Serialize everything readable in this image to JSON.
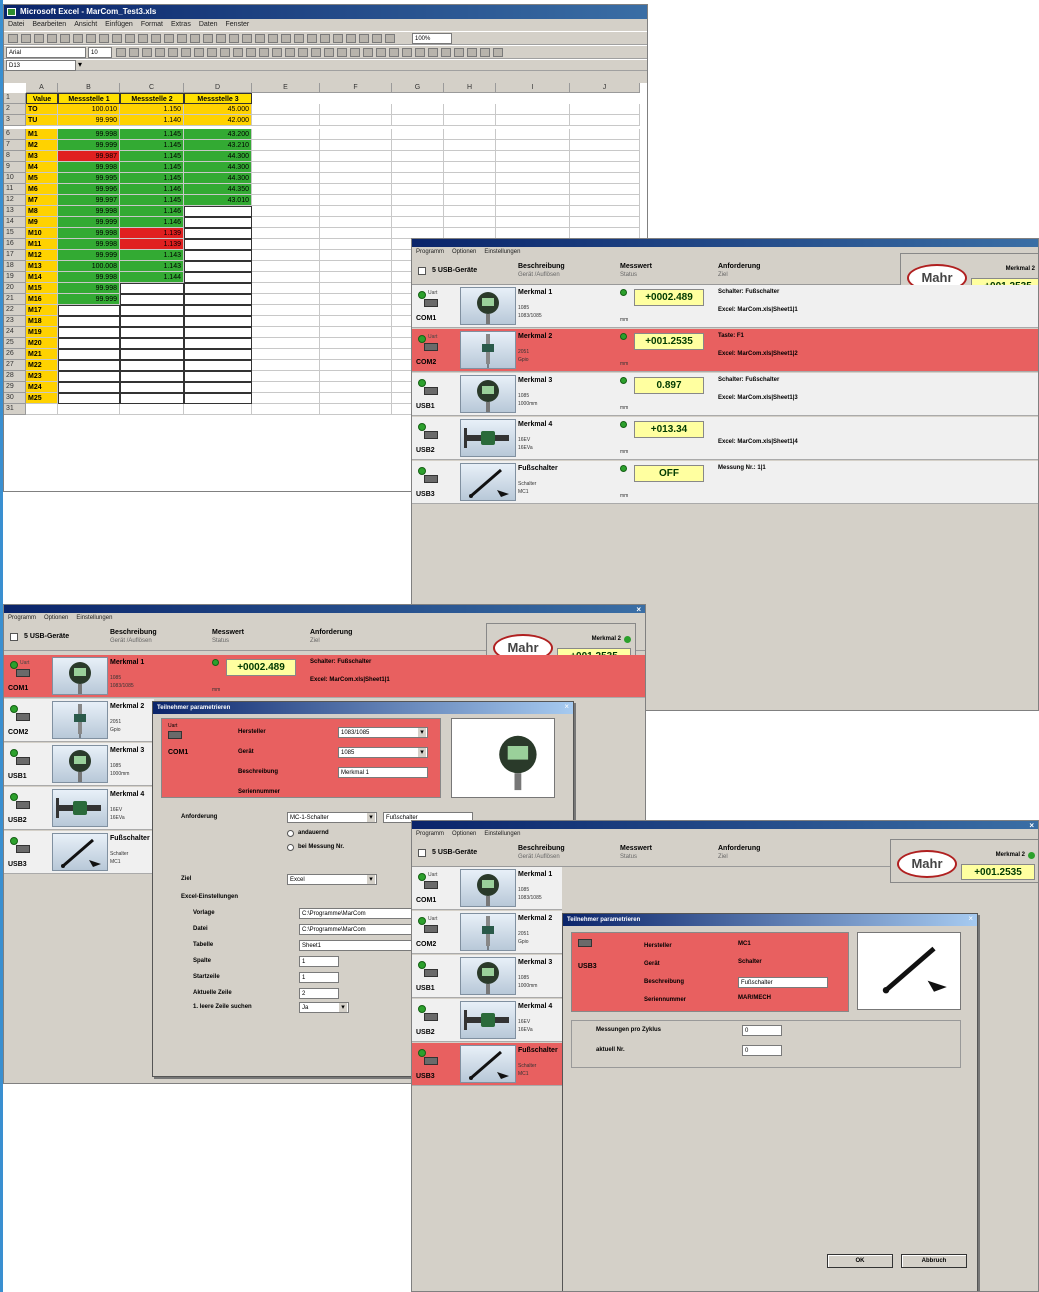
{
  "excel": {
    "title": "Microsoft Excel - MarCom_Test3.xls",
    "menu": [
      "Datei",
      "Bearbeiten",
      "Ansicht",
      "Einfügen",
      "Format",
      "Extras",
      "Daten",
      "Fenster"
    ],
    "zoom": "100%",
    "font_name": "Arial",
    "font_size": "10",
    "name_box": "D13",
    "columns": [
      "A",
      "B",
      "C",
      "D",
      "E",
      "F",
      "G",
      "H",
      "I",
      "J"
    ],
    "headers": [
      "Value",
      "Messstelle 1",
      "Messstelle 2",
      "Messstelle 3"
    ],
    "rows": [
      {
        "n": "2",
        "label": "TO",
        "b": "100.010",
        "c": "1.150",
        "d": "45.000",
        "style": "tol"
      },
      {
        "n": "3",
        "label": "TU",
        "b": "99.990",
        "c": "1.140",
        "d": "42.000",
        "style": "tol"
      },
      {
        "n": "6",
        "label": "M1",
        "b": "99.998",
        "c": "1.145",
        "d": "43.200",
        "style": "ok"
      },
      {
        "n": "7",
        "label": "M2",
        "b": "99.999",
        "c": "1.145",
        "d": "43.210",
        "style": "ok"
      },
      {
        "n": "8",
        "label": "M3",
        "b": "99.987",
        "c": "1.145",
        "d": "44.300",
        "style": "bad_b"
      },
      {
        "n": "9",
        "label": "M4",
        "b": "99.998",
        "c": "1.145",
        "d": "44.300",
        "style": "ok"
      },
      {
        "n": "10",
        "label": "M5",
        "b": "99.995",
        "c": "1.145",
        "d": "44.300",
        "style": "ok"
      },
      {
        "n": "11",
        "label": "M6",
        "b": "99.996",
        "c": "1.146",
        "d": "44.350",
        "style": "ok"
      },
      {
        "n": "12",
        "label": "M7",
        "b": "99.997",
        "c": "1.145",
        "d": "43.010",
        "style": "ok"
      },
      {
        "n": "13",
        "label": "M8",
        "b": "99.998",
        "c": "1.146",
        "d": "",
        "style": "ok_bc"
      },
      {
        "n": "14",
        "label": "M9",
        "b": "99.999",
        "c": "1.146",
        "d": "",
        "style": "ok_bc"
      },
      {
        "n": "15",
        "label": "M10",
        "b": "99.998",
        "c": "1.139",
        "d": "",
        "style": "bad_c"
      },
      {
        "n": "16",
        "label": "M11",
        "b": "99.998",
        "c": "1.139",
        "d": "",
        "style": "bad_c"
      },
      {
        "n": "17",
        "label": "M12",
        "b": "99.999",
        "c": "1.143",
        "d": "",
        "style": "ok_bc"
      },
      {
        "n": "18",
        "label": "M13",
        "b": "100.008",
        "c": "1.143",
        "d": "",
        "style": "ok_bc"
      },
      {
        "n": "19",
        "label": "M14",
        "b": "99.998",
        "c": "1.144",
        "d": "",
        "style": "ok_bc"
      },
      {
        "n": "20",
        "label": "M15",
        "b": "99.998",
        "c": "",
        "d": "",
        "style": "ok_b"
      },
      {
        "n": "21",
        "label": "M16",
        "b": "99.999",
        "c": "",
        "d": "",
        "style": "ok_b"
      },
      {
        "n": "22",
        "label": "M17",
        "b": "",
        "c": "",
        "d": "",
        "style": "empty"
      },
      {
        "n": "23",
        "label": "M18",
        "b": "",
        "c": "",
        "d": "",
        "style": "empty"
      },
      {
        "n": "24",
        "label": "M19",
        "b": "",
        "c": "",
        "d": "",
        "style": "empty"
      },
      {
        "n": "25",
        "label": "M20",
        "b": "",
        "c": "",
        "d": "",
        "style": "empty"
      },
      {
        "n": "26",
        "label": "M21",
        "b": "",
        "c": "",
        "d": "",
        "style": "empty"
      },
      {
        "n": "27",
        "label": "M22",
        "b": "",
        "c": "",
        "d": "",
        "style": "empty"
      },
      {
        "n": "28",
        "label": "M23",
        "b": "",
        "c": "",
        "d": "",
        "style": "empty"
      },
      {
        "n": "29",
        "label": "M24",
        "b": "",
        "c": "",
        "d": "",
        "style": "empty"
      },
      {
        "n": "30",
        "label": "M25",
        "b": "",
        "c": "",
        "d": "",
        "style": "empty"
      },
      {
        "n": "31",
        "label": "",
        "b": "",
        "c": "",
        "d": "",
        "style": "blank"
      }
    ]
  },
  "marcom": {
    "menu": [
      "Programm",
      "Optionen",
      "Einstellungen"
    ],
    "header": {
      "devices": "5 USB-Geräte",
      "desc": "Beschreibung",
      "desc_sub": "Gerät /Auflösen",
      "value": "Messwert",
      "value_sub": "Status",
      "req": "Anforderung",
      "req_sub": "Ziel"
    },
    "mahr": {
      "logo": "Mahr",
      "label": "Merkmal 2",
      "value": "+001.2535"
    },
    "devices": [
      {
        "tag": "Uart",
        "port": "COM1",
        "name": "Merkmal 1",
        "s1": "1085",
        "s2": "1083/1085",
        "unit": "mm",
        "value": "+0002.489",
        "a1": "Schalter: Fußschalter",
        "a2": "Excel: MarCom.xls|Sheet1|1"
      },
      {
        "tag": "Uart",
        "port": "COM2",
        "name": "Merkmal 2",
        "s1": "2051",
        "s2": "Gpio",
        "unit": "mm",
        "value": "+001.2535",
        "a1": "Taste: F1",
        "a2": "Excel: MarCom.xls|Sheet1|2"
      },
      {
        "tag": "",
        "port": "USB1",
        "name": "Merkmal 3",
        "s1": "1085",
        "s2": "1000mm",
        "unit": "mm",
        "value": "0.897",
        "a1": "Schalter: Fußschalter",
        "a2": "Excel: MarCom.xls|Sheet1|3"
      },
      {
        "tag": "",
        "port": "USB2",
        "name": "Merkmal 4",
        "s1": "16EV",
        "s2": "16EVa",
        "unit": "mm",
        "value": "+013.34",
        "a1": "",
        "a2": "Excel: MarCom.xls|Sheet1|4"
      },
      {
        "tag": "",
        "port": "USB3",
        "name": "Fußschalter",
        "s1": "Schalter",
        "s2": "MC1",
        "unit": "mm",
        "value": "OFF",
        "a1": "Messung Nr.: 1|1",
        "a2": ""
      }
    ],
    "dialog1": {
      "title": "Teilnehmer parametrieren",
      "port": "COM1",
      "tag": "Uart",
      "f_hersteller": "Hersteller",
      "v_hersteller": "1083/1085",
      "f_geraet": "Gerät",
      "v_geraet": "1085",
      "f_beschreibung": "Beschreibung",
      "v_beschreibung": "Merkmal 1",
      "f_seriennummer": "Seriennummer",
      "anforderung": "Anforderung",
      "v_anforderung": "MC-1-Schalter",
      "v_anforderung2": "Fußschalter",
      "opt1": "andauernd",
      "opt2": "bei Messung Nr.",
      "ziel": "Ziel",
      "v_ziel": "Excel",
      "excel_settings": "Excel-Einstellungen",
      "f_vorlage": "Vorlage",
      "v_vorlage": "C:\\Programme\\MarCom",
      "f_datei": "Datei",
      "v_datei": "C:\\Programme\\MarCom",
      "f_tabelle": "Tabelle",
      "v_tabelle": "Sheet1",
      "f_spalte": "Spalte",
      "v_spalte": "1",
      "f_startzeile": "Startzeile",
      "v_startzeile": "1",
      "f_aktuelle": "Aktuelle Zeile",
      "v_aktuelle": "2",
      "f_leere": "1. leere Zeile suchen",
      "v_leere": "Ja"
    },
    "dialog2": {
      "title": "Teilnehmer parametrieren",
      "port": "USB3",
      "f_hersteller": "Hersteller",
      "v_hersteller": "MC1",
      "f_geraet": "Gerät",
      "v_geraet": "Schalter",
      "f_beschreibung": "Beschreibung",
      "v_beschreibung": "Fußschalter",
      "f_seriennummer": "Seriennummer",
      "v_seriennummer": "MAR/MECH",
      "f_messungen": "Messungen pro Zyklus",
      "v_messungen": "0",
      "f_aktuell": "aktuell Nr.",
      "v_aktuell": "0",
      "ok": "OK",
      "cancel": "Abbruch"
    }
  },
  "colors": {
    "green": "#33aa33",
    "red": "#e02020",
    "yellow": "#ffd200",
    "rowred": "#e86060"
  }
}
